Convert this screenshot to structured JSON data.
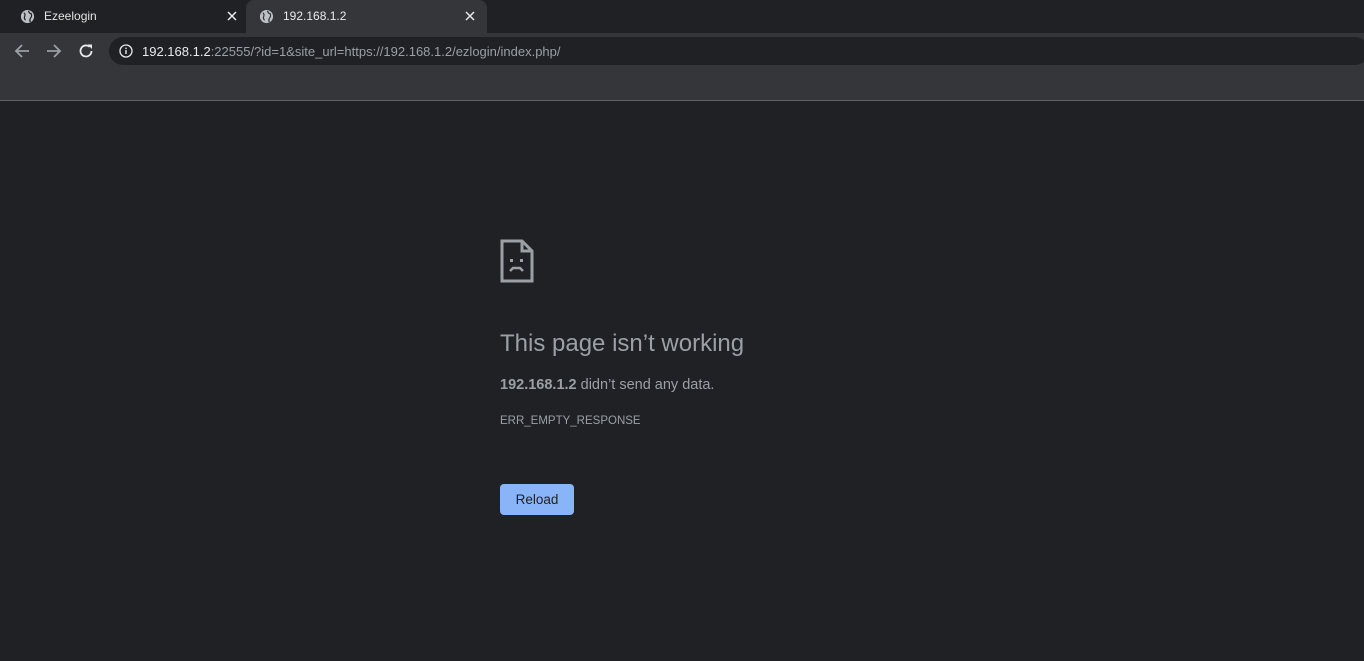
{
  "tabs": [
    {
      "title": "Ezeelogin",
      "favicon": "globe-icon",
      "active": false
    },
    {
      "title": "192.168.1.2",
      "favicon": "globe-icon",
      "active": true
    }
  ],
  "omnibox": {
    "host": "192.168.1.2",
    "rest": ":22555/?id=1&site_url=https://192.168.1.2/ezlogin/index.php/"
  },
  "error": {
    "heading": "This page isn’t working",
    "host_bold": "192.168.1.2",
    "message_rest": " didn’t send any data.",
    "code": "ERR_EMPTY_RESPONSE",
    "reload_label": "Reload"
  },
  "colors": {
    "background": "#202124",
    "toolbar": "#35363a",
    "text_muted": "#9aa0a6",
    "button_blue": "#8ab4f8"
  }
}
